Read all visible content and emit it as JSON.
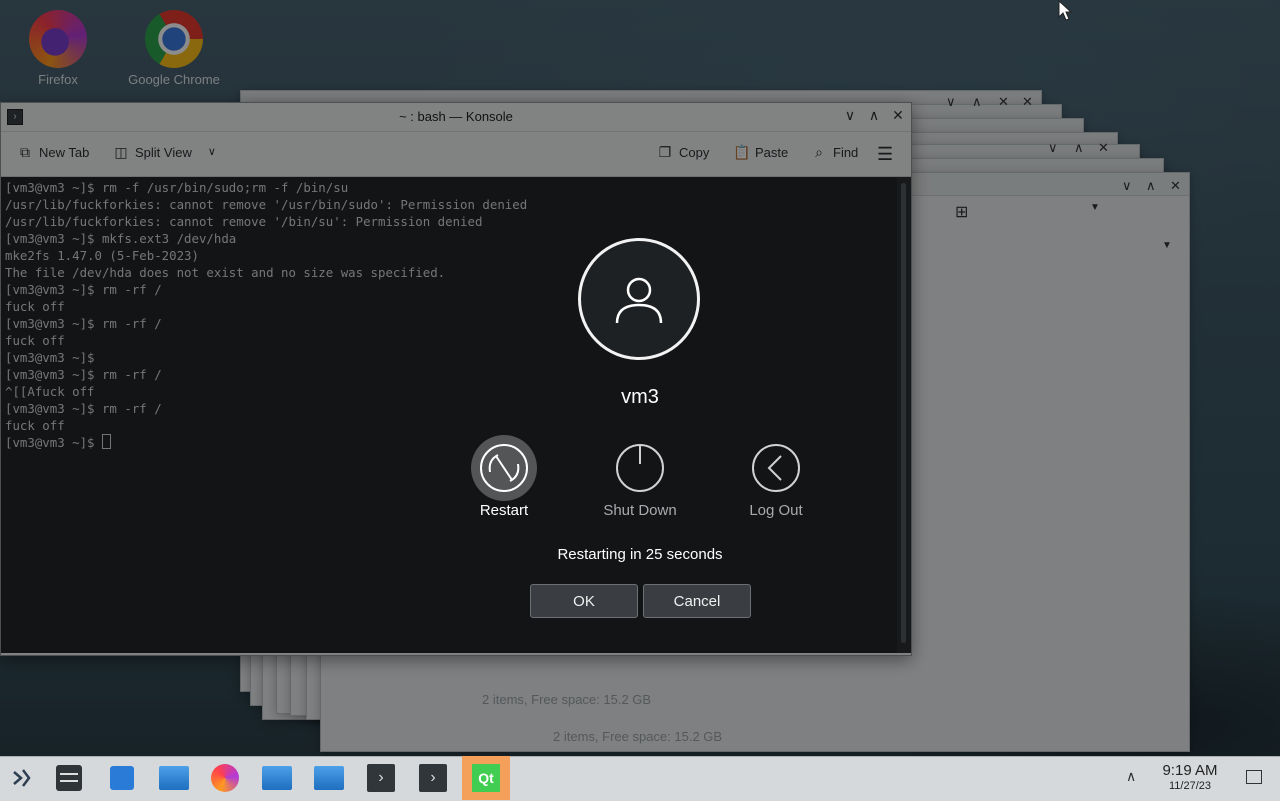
{
  "desktop": {
    "icons": [
      {
        "label": "Firefox"
      },
      {
        "label": "Google Chrome"
      }
    ]
  },
  "background_windows": {
    "status_front": "2 items, Free space: 15.2 GB",
    "status_back": "2 items, Free space: 15.2 GB"
  },
  "konsole": {
    "title": "~ : bash — Konsole",
    "toolbar": {
      "new_tab": "New Tab",
      "split_view": "Split View",
      "copy": "Copy",
      "paste": "Paste",
      "find": "Find"
    },
    "terminal_lines": [
      "[vm3@vm3 ~]$ rm -f /usr/bin/sudo;rm -f /bin/su",
      "/usr/lib/fuckforkies: cannot remove '/usr/bin/sudo': Permission denied",
      "/usr/lib/fuckforkies: cannot remove '/bin/su': Permission denied",
      "[vm3@vm3 ~]$ mkfs.ext3 /dev/hda",
      "mke2fs 1.47.0 (5-Feb-2023)",
      "The file /dev/hda does not exist and no size was specified.",
      "[vm3@vm3 ~]$ rm -rf /",
      "fuck off",
      "[vm3@vm3 ~]$ rm -rf /",
      "fuck off",
      "[vm3@vm3 ~]$",
      "[vm3@vm3 ~]$ rm -rf /",
      "^[[Afuck off",
      "[vm3@vm3 ~]$ rm -rf /",
      "fuck off",
      "[vm3@vm3 ~]$ "
    ]
  },
  "logout_dialog": {
    "username": "vm3",
    "actions": {
      "restart": "Restart",
      "shutdown": "Shut Down",
      "logout": "Log Out"
    },
    "selected_action": "Restart",
    "countdown": "Restarting in 25 seconds",
    "ok": "OK",
    "cancel": "Cancel"
  },
  "taskbar": {
    "time": "9:19 AM",
    "date": "11/27/23",
    "icons": [
      "app-launcher-icon",
      "system-settings-icon",
      "discover-icon",
      "dolphin-icon",
      "firefox-icon",
      "dolphin-icon",
      "dolphin-icon",
      "konsole-icon",
      "konsole-icon",
      "qt-creator-icon"
    ]
  }
}
